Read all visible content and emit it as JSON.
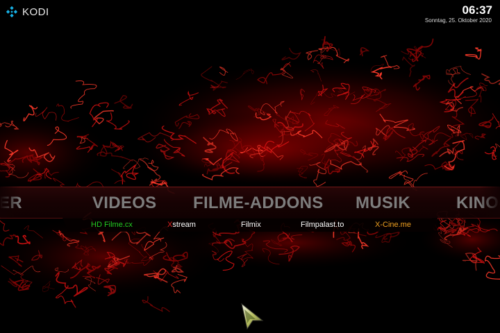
{
  "app": {
    "logo_text": "KODI"
  },
  "status": {
    "time": "06:37",
    "date": "Sonntag, 25. Oktober 2020"
  },
  "menu": {
    "items": [
      "ER",
      "VIDEOS",
      "FILME-ADDONS",
      "MUSIK",
      "KINO-"
    ],
    "selected": "FILME-ADDONS"
  },
  "submenu": {
    "items": [
      {
        "first": "",
        "rest": "HD Filme.cx",
        "color": "#22cc22"
      },
      {
        "first": "X",
        "rest": "stream",
        "color": "#ffffff",
        "first_color": "#e02020"
      },
      {
        "first": "",
        "rest": "Filmix",
        "color": "#ffffff"
      },
      {
        "first": "",
        "rest": "Filmpalast.to",
        "color": "#ffffff"
      },
      {
        "first": "",
        "rest": "X-Cine.me",
        "color": "#f0a020"
      }
    ]
  },
  "colors": {
    "accent": "#c00000",
    "menu_text": "#7d7d7d",
    "background": "#000000"
  },
  "icons": {
    "logo": "kodi-logo-icon",
    "pointer": "mouse-pointer-icon"
  }
}
